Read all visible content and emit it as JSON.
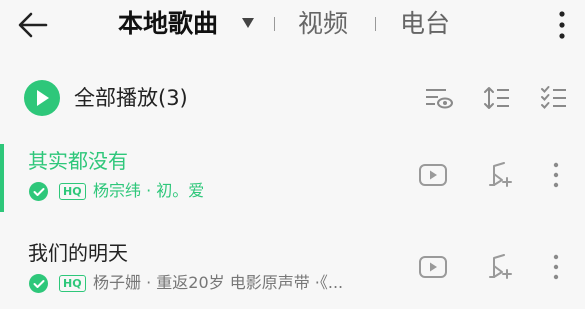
{
  "header": {
    "tabs": [
      {
        "label": "本地歌曲",
        "active": true
      },
      {
        "label": "视频",
        "active": false
      },
      {
        "label": "电台",
        "active": false
      }
    ]
  },
  "play_all": {
    "label": "全部播放(3)"
  },
  "songs": [
    {
      "title": "其实都没有",
      "subtitle": "杨宗纬 · 初。爱",
      "quality": "HQ",
      "playing": true
    },
    {
      "title": "我们的明天",
      "subtitle": "杨子姗 · 重返20岁 电影原声带 ·《...",
      "quality": "HQ",
      "playing": false
    }
  ],
  "colors": {
    "accent": "#2ec77a",
    "background": "#f7f7f7",
    "icon_gray": "#9a9a9a"
  },
  "icons": [
    "back-arrow-icon",
    "dropdown-caret-icon",
    "more-vertical-icon",
    "play-icon",
    "eye-filter-icon",
    "sort-icon",
    "multi-select-icon",
    "check-icon",
    "video-play-icon",
    "add-to-playlist-icon"
  ]
}
